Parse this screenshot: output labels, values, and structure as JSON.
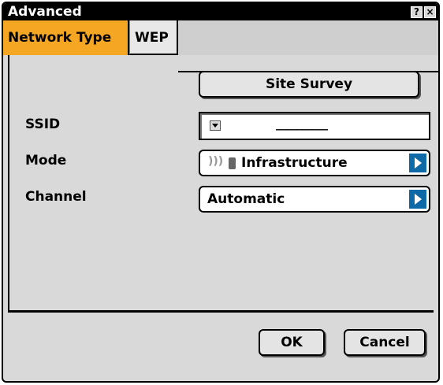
{
  "window": {
    "title": "Advanced",
    "help_label": "?",
    "close_label": "×"
  },
  "tabs": [
    {
      "label": "Network Type",
      "active": true
    },
    {
      "label": "WEP",
      "active": false
    }
  ],
  "site_survey_button": "Site Survey",
  "ssid": {
    "label": "SSID",
    "value": "__________"
  },
  "mode": {
    "label": "Mode",
    "value": "Infrastructure",
    "icons": [
      "signal-waves-icon",
      "device-icon"
    ]
  },
  "channel": {
    "label": "Channel",
    "value": "Automatic"
  },
  "footer": {
    "ok_label": "OK",
    "cancel_label": "Cancel"
  },
  "colors": {
    "active_tab": "#f5a623",
    "arrow_button": "#0e6aa6",
    "dialog_bg": "#d9d9d9"
  }
}
